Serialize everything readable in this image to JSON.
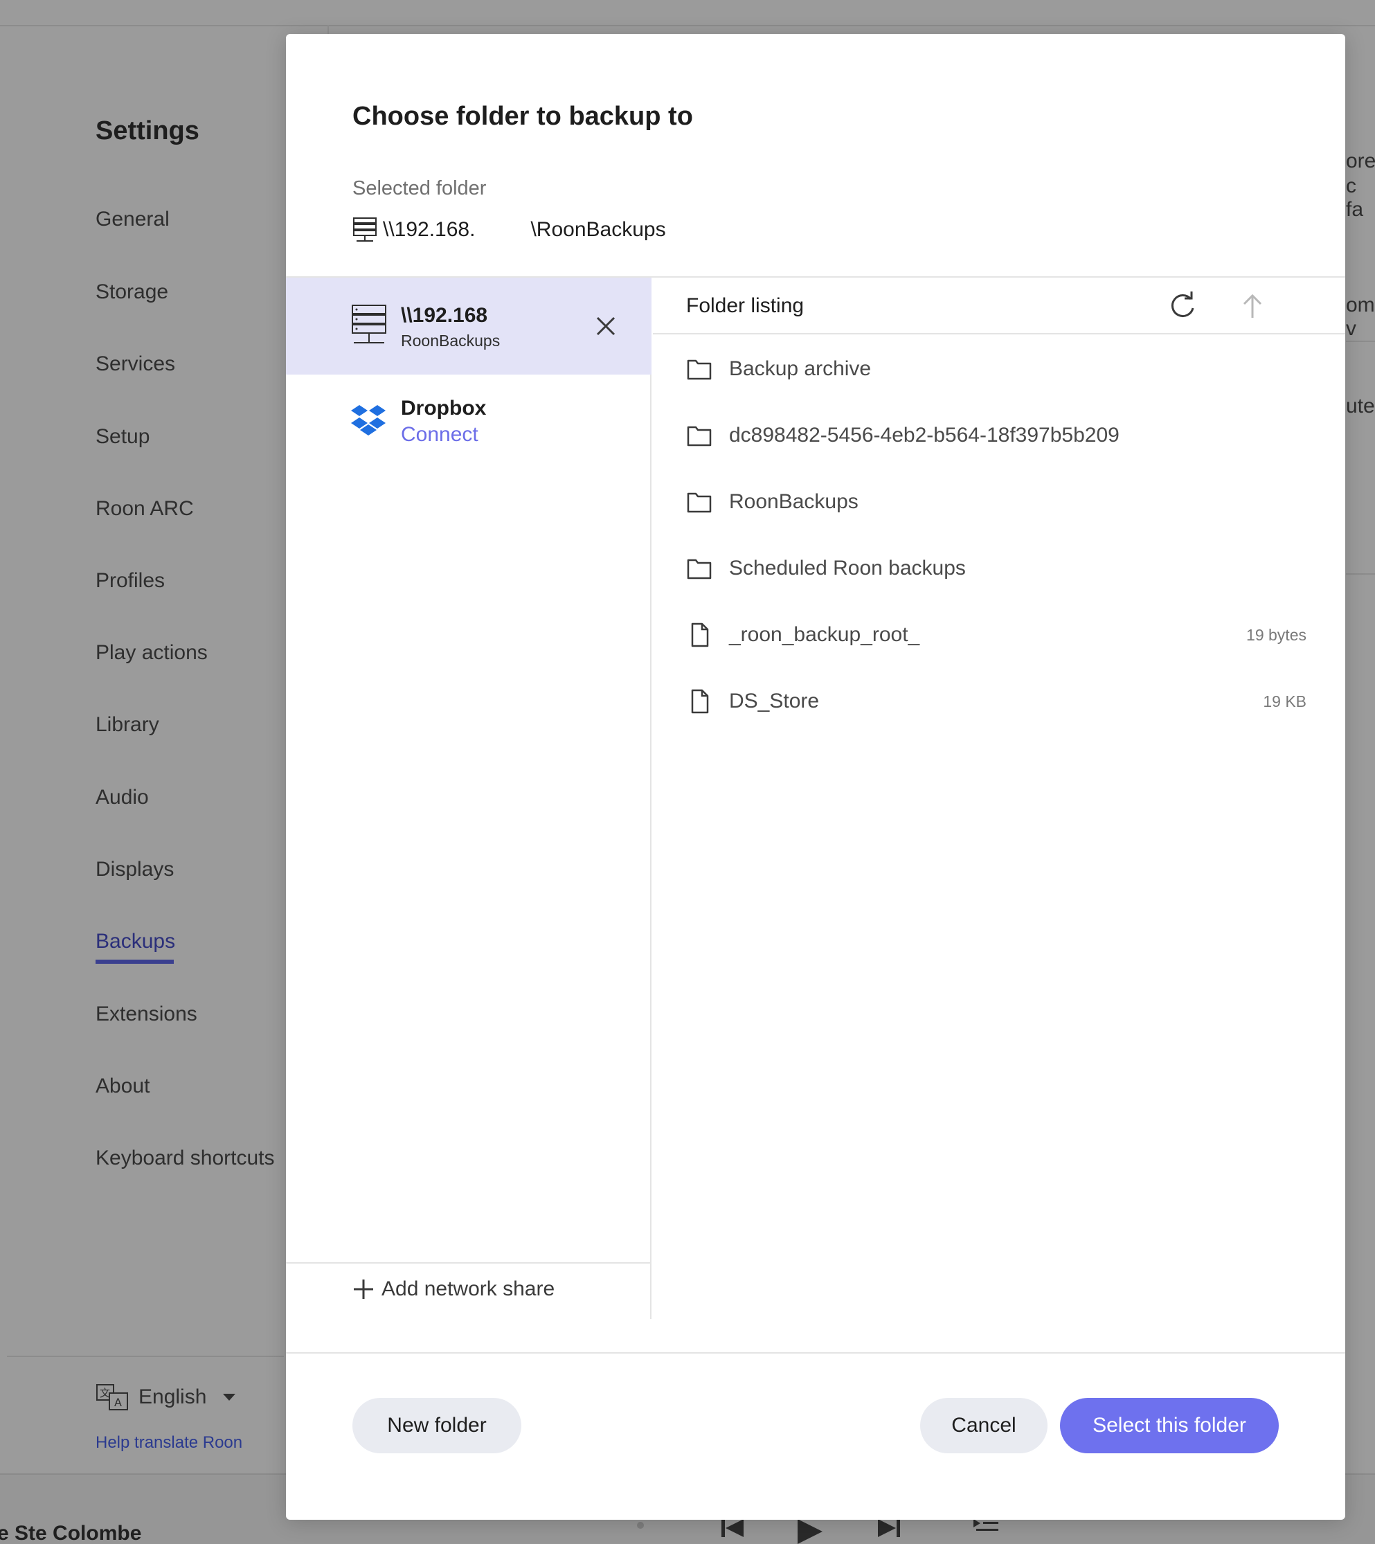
{
  "background": {
    "settings_title": "Settings",
    "nav_items": [
      {
        "label": "General"
      },
      {
        "label": "Storage"
      },
      {
        "label": "Services"
      },
      {
        "label": "Setup"
      },
      {
        "label": "Roon ARC"
      },
      {
        "label": "Profiles"
      },
      {
        "label": "Play actions"
      },
      {
        "label": "Library"
      },
      {
        "label": "Audio"
      },
      {
        "label": "Displays"
      },
      {
        "label": "Backups",
        "active": true
      },
      {
        "label": "Extensions"
      },
      {
        "label": "About"
      },
      {
        "label": "Keyboard shortcuts"
      }
    ],
    "language": "English",
    "help_translate": "Help translate Roon",
    "now_playing": "e Ste Colombe",
    "right_fragments": [
      "ore",
      "c fa",
      "om v",
      "ute"
    ]
  },
  "modal": {
    "title": "Choose folder to backup to",
    "selected_label": "Selected folder",
    "selected_path_prefix": "\\\\192.168.",
    "selected_path_suffix": "\\RoonBackups",
    "shares": {
      "network": {
        "host": "\\\\192.168",
        "name": "RoonBackups"
      },
      "dropbox": {
        "name": "Dropbox",
        "action": "Connect"
      }
    },
    "add_share_label": "Add network share",
    "listing_title": "Folder listing",
    "items": [
      {
        "type": "folder",
        "name": "Backup archive",
        "size": ""
      },
      {
        "type": "folder",
        "name": "dc898482-5456-4eb2-b564-18f397b5b209",
        "size": ""
      },
      {
        "type": "folder",
        "name": "RoonBackups",
        "size": ""
      },
      {
        "type": "folder",
        "name": "Scheduled Roon backups",
        "size": ""
      },
      {
        "type": "file",
        "name": "_roon_backup_root_",
        "size": "19 bytes"
      },
      {
        "type": "file",
        "name": "DS_Store",
        "size": "19 KB"
      }
    ],
    "buttons": {
      "new_folder": "New folder",
      "cancel": "Cancel",
      "select": "Select this folder"
    },
    "colors": {
      "accent": "#6e71ee",
      "selected_row": "#e3e3f7",
      "link": "#6b6de8"
    }
  }
}
